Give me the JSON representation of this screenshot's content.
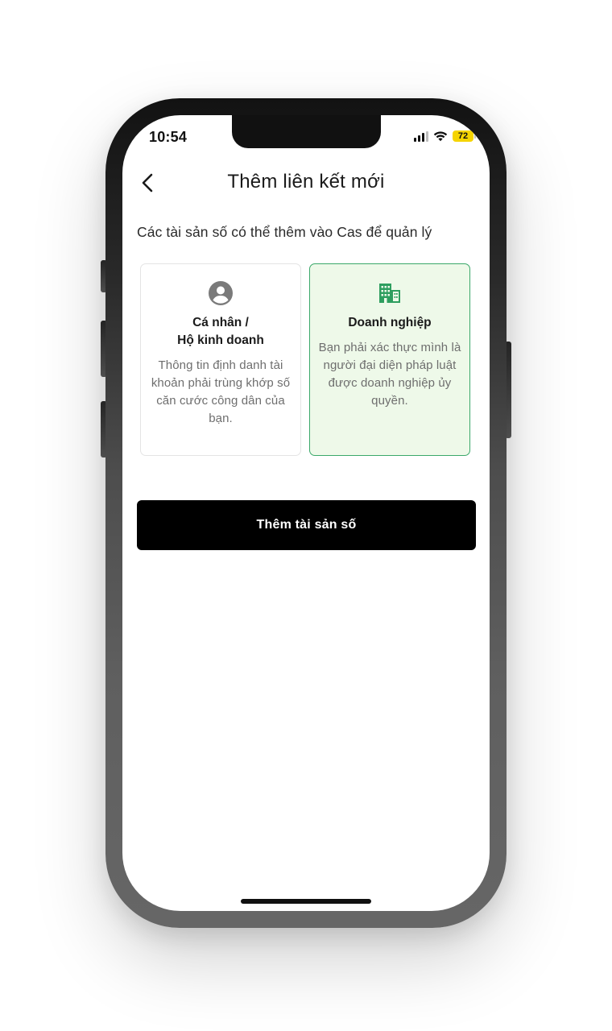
{
  "status_bar": {
    "time": "10:54",
    "battery": "72",
    "icons": [
      "cellular-signal-icon",
      "wifi-icon",
      "battery-icon"
    ]
  },
  "header": {
    "back_icon": "chevron-left-icon",
    "title": "Thêm liên kết mới"
  },
  "subtitle": "Các tài sản số có thể thêm vào Cas để quản lý",
  "cards": [
    {
      "icon": "user-circle-icon",
      "title_line1": "Cá nhân /",
      "title_line2": "Hộ kinh doanh",
      "description": "Thông tin định danh tài khoản phải trùng khớp số căn cước công dân của bạn.",
      "selected": false
    },
    {
      "icon": "building-icon",
      "title_line1": "Doanh nghiệp",
      "description": "Bạn phải xác thực mình là người đại diện pháp luật được doanh nghiệp ủy quyền.",
      "selected": true
    }
  ],
  "primary_button": {
    "label": "Thêm tài sản số"
  },
  "colors": {
    "accent_green": "#2e9e5f",
    "selected_card_bg": "#eef9e9",
    "button_bg": "#000000",
    "battery_yellow": "#f5d400"
  }
}
